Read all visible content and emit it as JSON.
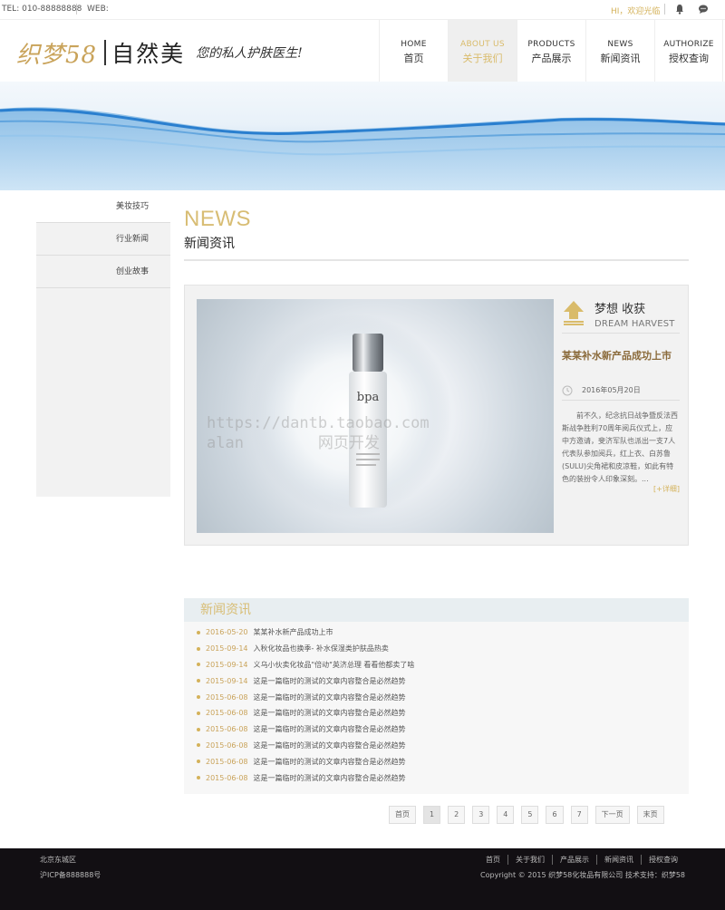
{
  "topbar": {
    "tel": "TEL: 010-88888888",
    "web": "WEB:",
    "greeting": "HI，欢迎光临"
  },
  "header": {
    "brand": "织梦58",
    "name": "自然美",
    "slogan": "您的私人护肤医生!"
  },
  "nav": [
    {
      "en": "HOME",
      "zh": "首页"
    },
    {
      "en": "ABOUT US",
      "zh": "关于我们"
    },
    {
      "en": "PRODUCTS",
      "zh": "产品展示"
    },
    {
      "en": "NEWS",
      "zh": "新闻资讯"
    },
    {
      "en": "AUTHORIZE",
      "zh": "授权查询"
    }
  ],
  "sidebar": [
    "美妆技巧",
    "行业新闻",
    "创业故事"
  ],
  "section": {
    "en": "NEWS",
    "zh": "新闻资讯"
  },
  "featured": {
    "head_zh": "梦想 收获",
    "head_en": "DREAM HARVEST",
    "title": "某某补水新产品成功上市",
    "date": "2016年05月20日",
    "summary": "前不久，纪念抗日战争暨反法西斯战争胜利70周年阅兵仪式上，应中方邀请，斐济军队也派出一支7人代表队参加阅兵，红上衣、白苏鲁(SULU)尖角裙和皮凉鞋，如此有特色的装扮令人印象深刻。...",
    "more": "[+详细]",
    "bottle_label": "bpa"
  },
  "watermark": [
    "https://dantb.taobao.com",
    "alan        网页开发"
  ],
  "news": {
    "title": "新闻资讯",
    "items": [
      {
        "date": "2016-05-20",
        "title": "某某补水新产品成功上市"
      },
      {
        "date": "2015-09-14",
        "title": "入秋化妆品也换季- 补水保湿类护肤品热卖"
      },
      {
        "date": "2015-09-14",
        "title": "义乌小伙卖化妆品\"倍动\"英济总理 看看他都卖了啥"
      },
      {
        "date": "2015-09-14",
        "title": "这是一篇临时的测试的文章内容整合是必然趋势"
      },
      {
        "date": "2015-06-08",
        "title": "这是一篇临时的测试的文章内容整合是必然趋势"
      },
      {
        "date": "2015-06-08",
        "title": "这是一篇临时的测试的文章内容整合是必然趋势"
      },
      {
        "date": "2015-06-08",
        "title": "这是一篇临时的测试的文章内容整合是必然趋势"
      },
      {
        "date": "2015-06-08",
        "title": "这是一篇临时的测试的文章内容整合是必然趋势"
      },
      {
        "date": "2015-06-08",
        "title": "这是一篇临时的测试的文章内容整合是必然趋势"
      },
      {
        "date": "2015-06-08",
        "title": "这是一篇临时的测试的文章内容整合是必然趋势"
      }
    ]
  },
  "pager": [
    "首页",
    "1",
    "2",
    "3",
    "4",
    "5",
    "6",
    "7",
    "下一页",
    "末页"
  ],
  "footer": {
    "address": "北京东城区",
    "icp": "沪ICP备888888号",
    "nav": [
      "首页",
      "关于我们",
      "产品展示",
      "新闻资讯",
      "授权查询"
    ],
    "copyright": "Copyright © 2015 织梦58化妆品有限公司 技术支持：织梦58"
  },
  "colors": {
    "accent": "#d4b25a",
    "footer_bg": "#120f13"
  }
}
